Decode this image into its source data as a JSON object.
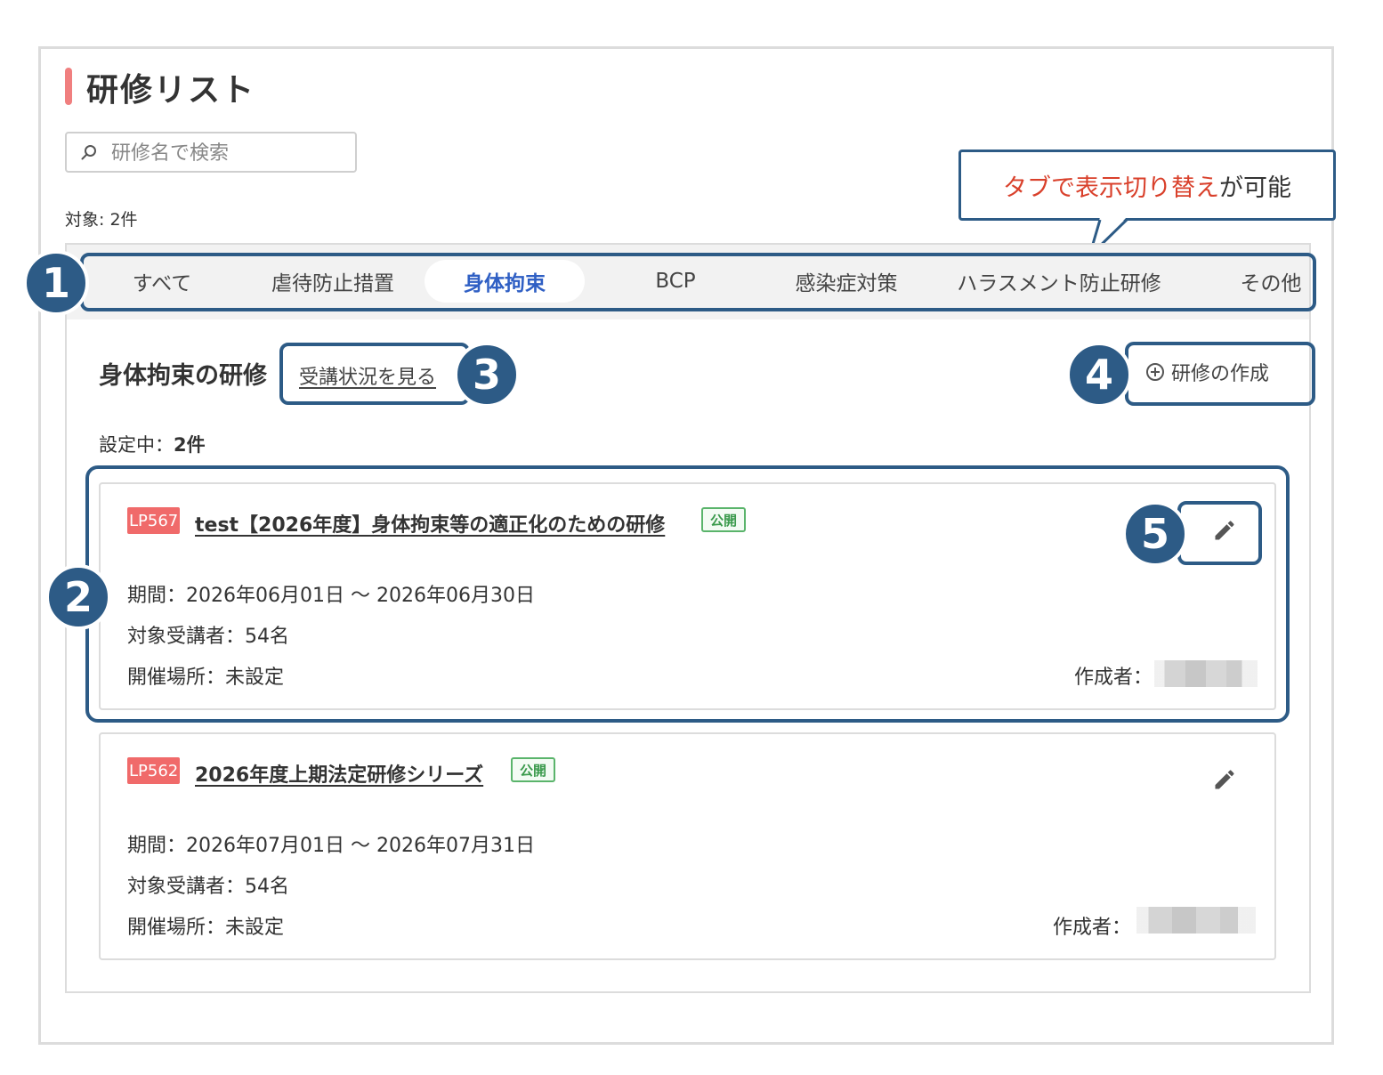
{
  "page": {
    "title": "研修リスト"
  },
  "search": {
    "placeholder": "研修名で検索"
  },
  "count": "対象: 2件",
  "callout": {
    "highlight": "タブで表示切り替え",
    "rest": "が可能"
  },
  "tabs": [
    {
      "label": "すべて"
    },
    {
      "label": "虐待防止措置"
    },
    {
      "label": "身体拘束"
    },
    {
      "label": "BCP"
    },
    {
      "label": "感染症対策"
    },
    {
      "label": "ハラスメント防止研修"
    },
    {
      "label": "その他"
    }
  ],
  "active_tab": "身体拘束",
  "section": {
    "title": "身体拘束の研修",
    "status_link": "受講状況を見る",
    "create_label": "研修の作成",
    "active_label": "設定中：",
    "active_count": "2件"
  },
  "badges": [
    "1",
    "2",
    "3",
    "4",
    "5"
  ],
  "trainings": [
    {
      "code": "LP567",
      "title": "test【2026年度】身体拘束等の適正化のための研修",
      "status": "公開",
      "period": "期間：2026年06月01日 〜 2026年06月30日",
      "attendees": "対象受講者：54名",
      "venue": "開催場所：未設定",
      "author_label": "作成者："
    },
    {
      "code": "LP562",
      "title": "2026年度上期法定研修シリーズ",
      "status": "公開",
      "period": "期間：2026年07月01日 〜 2026年07月31日",
      "attendees": "対象受講者：54名",
      "venue": "開催場所：未設定",
      "author_label": "作成者："
    }
  ],
  "colors": {
    "accent_bar": "#f07f7f",
    "annotation": "#2d5b86",
    "active_tab_text": "#2f5fc4",
    "code_badge": "#f06a6a",
    "public_badge": "#5ab46b",
    "callout_highlight": "#d9402b"
  },
  "icons": [
    "search-icon",
    "plus-circle-icon",
    "pencil-icon"
  ]
}
